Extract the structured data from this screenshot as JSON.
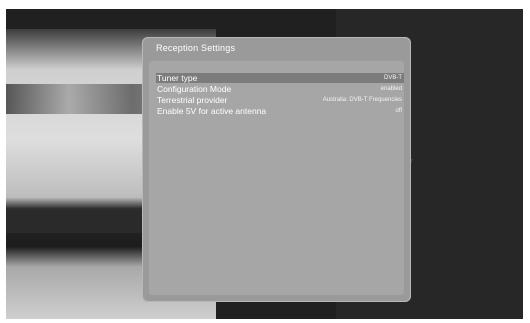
{
  "dialog": {
    "title": "Reception Settings",
    "rows": [
      {
        "label": "Tuner type",
        "value": "DVB-T",
        "selected": true
      },
      {
        "label": "Configuration Mode",
        "value": "enabled"
      },
      {
        "label": "Terrestrial provider",
        "value": "Australia: DVB-T Frequencies"
      },
      {
        "label": "Enable 5V for active antenna",
        "value": "off"
      }
    ]
  }
}
